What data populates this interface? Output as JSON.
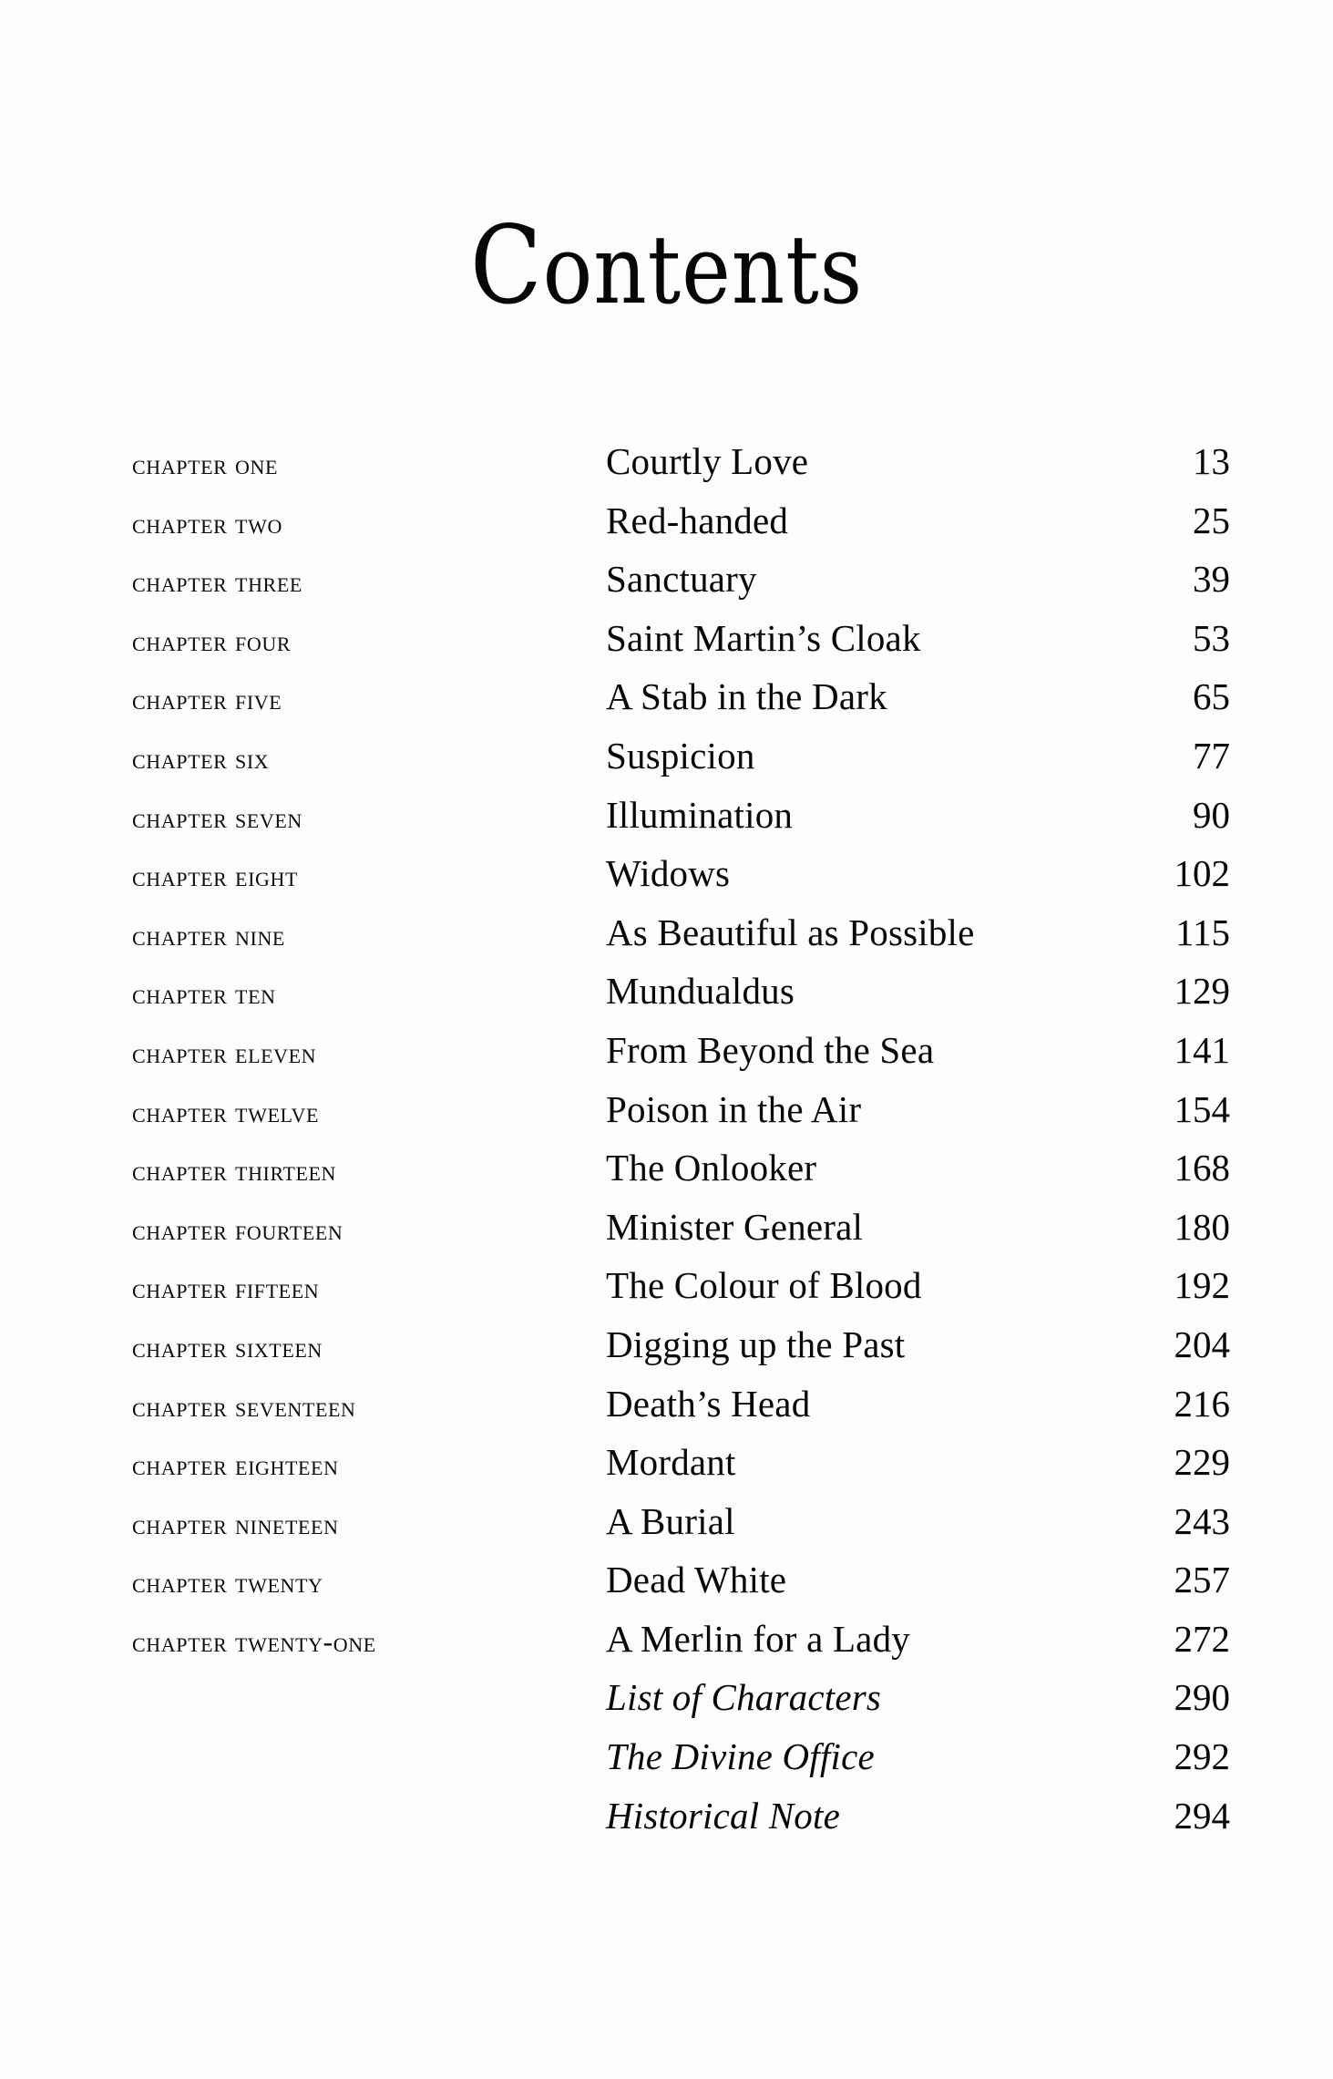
{
  "page": {
    "title": "Contents",
    "title_initial": "C",
    "title_rest": "ontents",
    "background_color": "#fdfdfc",
    "text_color": "#0a0a0a"
  },
  "columns": {
    "label_header": "",
    "title_header": "",
    "page_header": ""
  },
  "entries": [
    {
      "label": "Chapter One",
      "title": "Courtly Love",
      "page": "13",
      "style": "chapter"
    },
    {
      "label": "Chapter Two",
      "title": "Red-handed",
      "page": "25",
      "style": "chapter"
    },
    {
      "label": "Chapter Three",
      "title": "Sanctuary",
      "page": "39",
      "style": "chapter"
    },
    {
      "label": "Chapter Four",
      "title": "Saint Martin’s Cloak",
      "page": "53",
      "style": "chapter"
    },
    {
      "label": "Chapter Five",
      "title": "A Stab in the Dark",
      "page": "65",
      "style": "chapter"
    },
    {
      "label": "Chapter Six",
      "title": "Suspicion",
      "page": "77",
      "style": "chapter"
    },
    {
      "label": "Chapter Seven",
      "title": "Illumination",
      "page": "90",
      "style": "chapter"
    },
    {
      "label": "Chapter Eight",
      "title": "Widows",
      "page": "102",
      "style": "chapter"
    },
    {
      "label": "Chapter Nine",
      "title": "As Beautiful as Possible",
      "page": "115",
      "style": "chapter"
    },
    {
      "label": "Chapter Ten",
      "title": "Mundualdus",
      "page": "129",
      "style": "chapter"
    },
    {
      "label": "Chapter Eleven",
      "title": "From Beyond the Sea",
      "page": "141",
      "style": "chapter"
    },
    {
      "label": "Chapter Twelve",
      "title": "Poison in the Air",
      "page": "154",
      "style": "chapter"
    },
    {
      "label": "Chapter Thirteen",
      "title": "The Onlooker",
      "page": "168",
      "style": "chapter"
    },
    {
      "label": "Chapter Fourteen",
      "title": "Minister General",
      "page": "180",
      "style": "chapter"
    },
    {
      "label": "Chapter Fifteen",
      "title": "The Colour of Blood",
      "page": "192",
      "style": "chapter"
    },
    {
      "label": "Chapter Sixteen",
      "title": "Digging up the Past",
      "page": "204",
      "style": "chapter"
    },
    {
      "label": "Chapter Seventeen",
      "title": "Death’s Head",
      "page": "216",
      "style": "chapter"
    },
    {
      "label": "Chapter Eighteen",
      "title": "Mordant",
      "page": "229",
      "style": "chapter"
    },
    {
      "label": "Chapter Nineteen",
      "title": "A Burial",
      "page": "243",
      "style": "chapter"
    },
    {
      "label": "Chapter Twenty",
      "title": "Dead White",
      "page": "257",
      "style": "chapter"
    },
    {
      "label": "Chapter Twenty-one",
      "title": "A Merlin for a Lady",
      "page": "272",
      "style": "chapter"
    },
    {
      "label": "",
      "title": "List of Characters",
      "page": "290",
      "style": "backmatter"
    },
    {
      "label": "",
      "title": "The Divine Office",
      "page": "292",
      "style": "backmatter"
    },
    {
      "label": "",
      "title": "Historical Note",
      "page": "294",
      "style": "backmatter"
    }
  ]
}
